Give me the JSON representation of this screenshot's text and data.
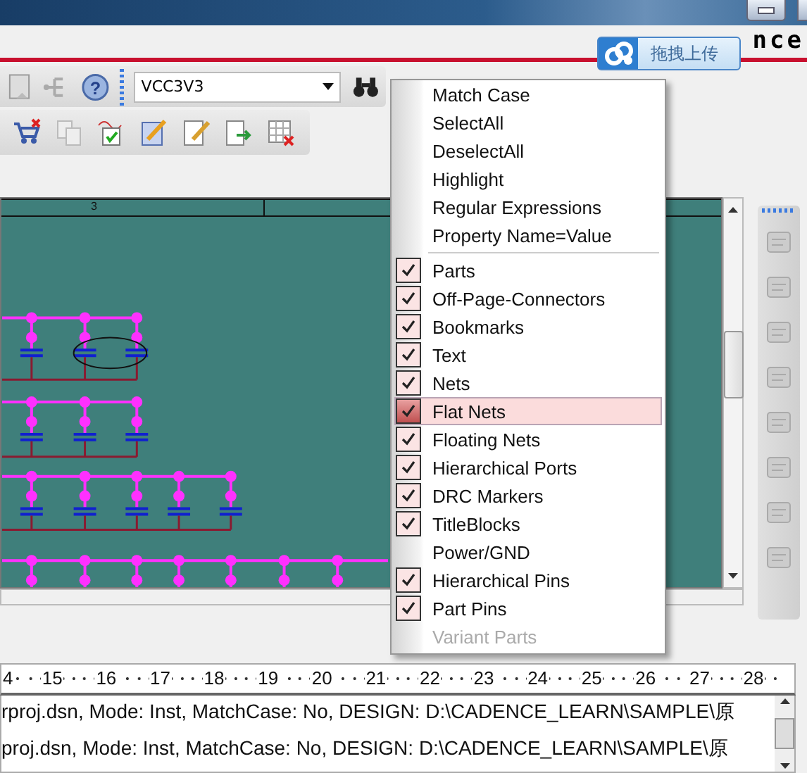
{
  "logo": {
    "text": "nce"
  },
  "upload_button": {
    "label": "拖拽上传"
  },
  "toolbar": {
    "help_glyph": "?",
    "search_combo": {
      "value": "VCC3V3"
    }
  },
  "schematic": {
    "zone_labels": [
      "3"
    ]
  },
  "find_menu": {
    "options": [
      {
        "label": "Match Case"
      },
      {
        "label": "SelectAll"
      },
      {
        "label": "DeselectAll"
      },
      {
        "label": "Highlight"
      },
      {
        "label": "Regular Expressions"
      },
      {
        "label": "Property Name=Value"
      }
    ],
    "filters": [
      {
        "label": "Parts",
        "checked": true,
        "selected": false,
        "disabled": false
      },
      {
        "label": "Off-Page-Connectors",
        "checked": true,
        "selected": false,
        "disabled": false
      },
      {
        "label": "Bookmarks",
        "checked": true,
        "selected": false,
        "disabled": false
      },
      {
        "label": "Text",
        "checked": true,
        "selected": false,
        "disabled": false
      },
      {
        "label": "Nets",
        "checked": true,
        "selected": false,
        "disabled": false
      },
      {
        "label": "Flat Nets",
        "checked": true,
        "selected": true,
        "disabled": false
      },
      {
        "label": "Floating Nets",
        "checked": true,
        "selected": false,
        "disabled": false
      },
      {
        "label": "Hierarchical Ports",
        "checked": true,
        "selected": false,
        "disabled": false
      },
      {
        "label": "DRC Markers",
        "checked": true,
        "selected": false,
        "disabled": false
      },
      {
        "label": "TitleBlocks",
        "checked": true,
        "selected": false,
        "disabled": false
      },
      {
        "label": "Power/GND",
        "checked": false,
        "selected": false,
        "disabled": false
      },
      {
        "label": "Hierarchical Pins",
        "checked": true,
        "selected": false,
        "disabled": false
      },
      {
        "label": "Part Pins",
        "checked": true,
        "selected": false,
        "disabled": false
      },
      {
        "label": "Variant Parts",
        "checked": false,
        "selected": false,
        "disabled": true
      }
    ]
  },
  "ruler": {
    "ticks": [
      "4",
      "15",
      "16",
      "17",
      "18",
      "19",
      "20",
      "21",
      "22",
      "23",
      "24",
      "25",
      "26",
      "27",
      "28"
    ]
  },
  "session_log": {
    "lines": [
      "rproj.dsn, Mode: Inst, MatchCase: No, DESIGN: D:\\CADENCE_LEARN\\SAMPLE\\原",
      "proj.dsn, Mode: Inst, MatchCase: No, DESIGN: D:\\CADENCE_LEARN\\SAMPLE\\原"
    ]
  }
}
